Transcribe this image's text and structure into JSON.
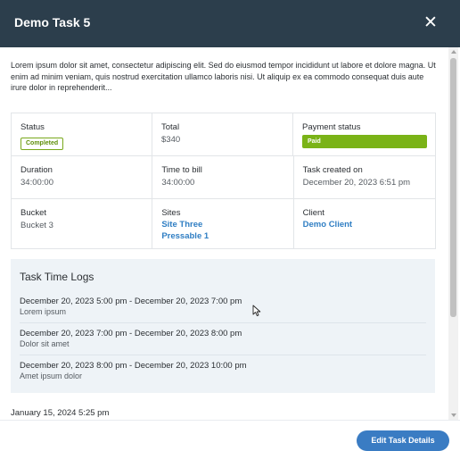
{
  "modal": {
    "title": "Demo Task 5",
    "close_glyph": "✕"
  },
  "description": "Lorem ipsum dolor sit amet, consectetur adipiscing elit. Sed do eiusmod tempor incididunt ut labore et dolore magna. Ut enim ad minim veniam, quis nostrud exercitation ullamco laboris nisi. Ut aliquip ex ea commodo consequat duis aute irure dolor in reprehenderit...",
  "details": {
    "status": {
      "label": "Status",
      "value": "Completed"
    },
    "total": {
      "label": "Total",
      "value": "$340"
    },
    "payment_status": {
      "label": "Payment status",
      "value": "Paid"
    },
    "duration": {
      "label": "Duration",
      "value": "34:00:00"
    },
    "time_to_bill": {
      "label": "Time to bill",
      "value": "34:00:00"
    },
    "task_created": {
      "label": "Task created on",
      "value": "December 20, 2023 6:51 pm"
    },
    "bucket": {
      "label": "Bucket",
      "value": "Bucket 3"
    },
    "sites": {
      "label": "Sites",
      "items": [
        "Site Three",
        "Pressable 1"
      ]
    },
    "client": {
      "label": "Client",
      "value": "Demo Client"
    }
  },
  "time_logs": {
    "title": "Task Time Logs",
    "entries": [
      {
        "range": "December 20, 2023 5:00 pm - December 20, 2023 7:00 pm",
        "note": "Lorem ipsum"
      },
      {
        "range": "December 20, 2023 7:00 pm - December 20, 2023 8:00 pm",
        "note": "Dolor sit amet"
      },
      {
        "range": "December 20, 2023 8:00 pm - December 20, 2023 10:00 pm",
        "note": "Amet ipsum dolor"
      }
    ]
  },
  "comment_date": "January 15, 2024 5:25 pm",
  "footer": {
    "edit_label": "Edit Task Details"
  },
  "colors": {
    "header_bg": "#2c3e4c",
    "completed_badge": "#79a81b",
    "paid_badge": "#7ab317",
    "link": "#2f7ec3",
    "primary_button": "#3a7cc3",
    "logs_bg": "#eef3f7"
  },
  "icons": {
    "close": "close-icon",
    "cursor": "mouse-pointer-icon"
  }
}
